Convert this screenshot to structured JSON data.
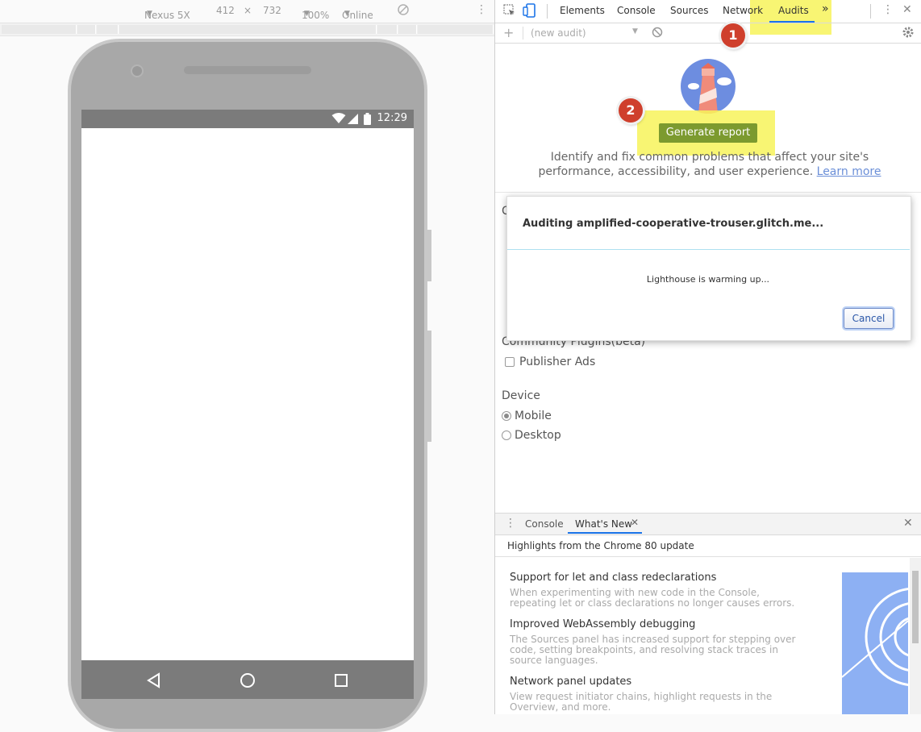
{
  "device_toolbar": {
    "device": "Nexus 5X",
    "width": "412",
    "times": "×",
    "height": "732",
    "zoom": "100%",
    "network": "Online"
  },
  "phone": {
    "status_time": "12:29"
  },
  "devtools": {
    "tabs": [
      "Elements",
      "Console",
      "Sources",
      "Network",
      "Audits"
    ],
    "more_tabs": "»",
    "audit_select": "(new audit)",
    "generate_report": "Generate report",
    "description_line1": "Identify and fix common problems that affect your site's",
    "description_line2": "performance, accessibility, and user experience.",
    "learn_more": "Learn more",
    "markers": [
      "1",
      "2"
    ],
    "dialog": {
      "title": "Auditing amplified-cooperative-trouser.glitch.me...",
      "message": "Lighthouse is warming up...",
      "cancel": "Cancel"
    },
    "category_partial": "C",
    "plugins_heading": "Community Plugins(beta)",
    "publisher_ads": "Publisher Ads",
    "device_heading": "Device",
    "device_options": [
      "Mobile",
      "Desktop"
    ],
    "selected_device": "Mobile"
  },
  "drawer": {
    "tabs": [
      "Console",
      "What's New"
    ],
    "active_tab": "What's New",
    "highlights": "Highlights from the Chrome 80 update",
    "items": [
      {
        "title": "Support for let and class redeclarations",
        "body": "When experimenting with new code in the Console, repeating let or class declarations no longer causes errors."
      },
      {
        "title": "Improved WebAssembly debugging",
        "body": "The Sources panel has increased support for stepping over code, setting breakpoints, and resolving stack traces in source languages."
      },
      {
        "title": "Network panel updates",
        "body": "View request initiator chains, highlight requests in the Overview, and more."
      }
    ]
  },
  "colors": {
    "highlight": "#f7f35a",
    "marker": "#cf3f2c",
    "generate_button": "#7c9a2f",
    "accent": "#1a73e8"
  }
}
